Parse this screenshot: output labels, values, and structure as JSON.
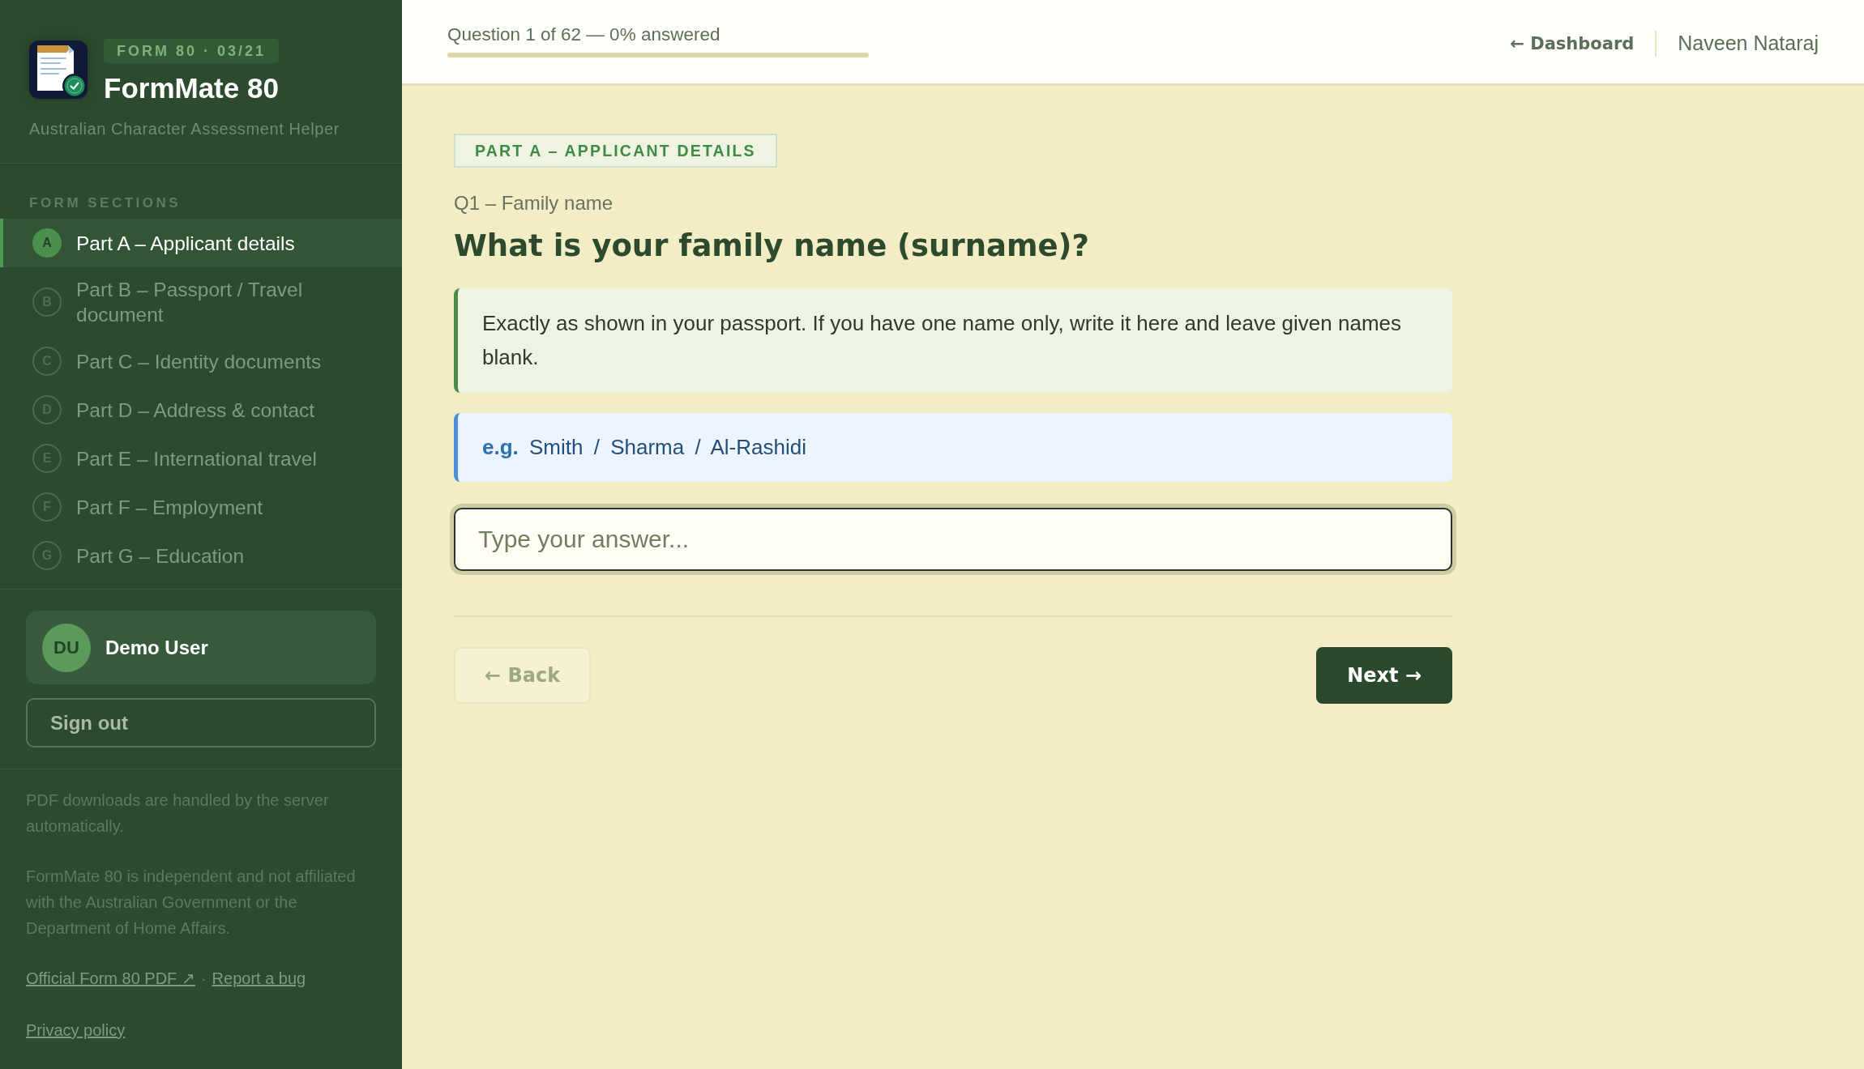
{
  "sidebar": {
    "brand": {
      "tag": "FORM 80 · 03/21",
      "title": "FormMate 80",
      "subtitle": "Australian Character Assessment Helper"
    },
    "nav_heading": "FORM SECTIONS",
    "sections": [
      {
        "letter": "A",
        "label": "Part A – Applicant details",
        "selected": true
      },
      {
        "letter": "B",
        "label": "Part B – Passport / Travel document",
        "selected": false
      },
      {
        "letter": "C",
        "label": "Part C – Identity documents",
        "selected": false
      },
      {
        "letter": "D",
        "label": "Part D – Address & contact",
        "selected": false
      },
      {
        "letter": "E",
        "label": "Part E – International travel",
        "selected": false
      },
      {
        "letter": "F",
        "label": "Part F – Employment",
        "selected": false
      },
      {
        "letter": "G",
        "label": "Part G – Education",
        "selected": false
      }
    ],
    "user": {
      "initials": "DU",
      "name": "Demo User"
    },
    "sign_out": "Sign out",
    "notes": [
      "PDF downloads are handled by the server automatically.",
      "FormMate 80 is independent and not affiliated with the Australian Government or the Department of Home Affairs."
    ],
    "link_rows": [
      {
        "links": [
          "Official Form 80 PDF ↗",
          "Report a bug"
        ],
        "separator": "·"
      },
      {
        "links": [
          "Privacy policy"
        ]
      }
    ]
  },
  "topbar": {
    "progress_text": "Question 1 of 62 — 0% answered",
    "progress": {
      "level": 0
    },
    "dashboard_link": "← Dashboard",
    "user_name": "Naveen Nataraj"
  },
  "question": {
    "section_tag": "PART A – APPLICANT DETAILS",
    "label": "Q1 – Family name",
    "title": "What is your family name (surname)?",
    "hint": "Exactly as shown in your passport. If you have one name only, write it here and leave given names blank.",
    "example": "**e.g.** Smith / Sharma / Al-Rashidi",
    "answer": {
      "placeholder": "Type your answer..."
    },
    "buttons": [
      {
        "label": "← Back",
        "kind": "secondary",
        "disabled": true
      },
      {
        "label": "Next →",
        "kind": "primary",
        "disabled": false
      }
    ]
  }
}
